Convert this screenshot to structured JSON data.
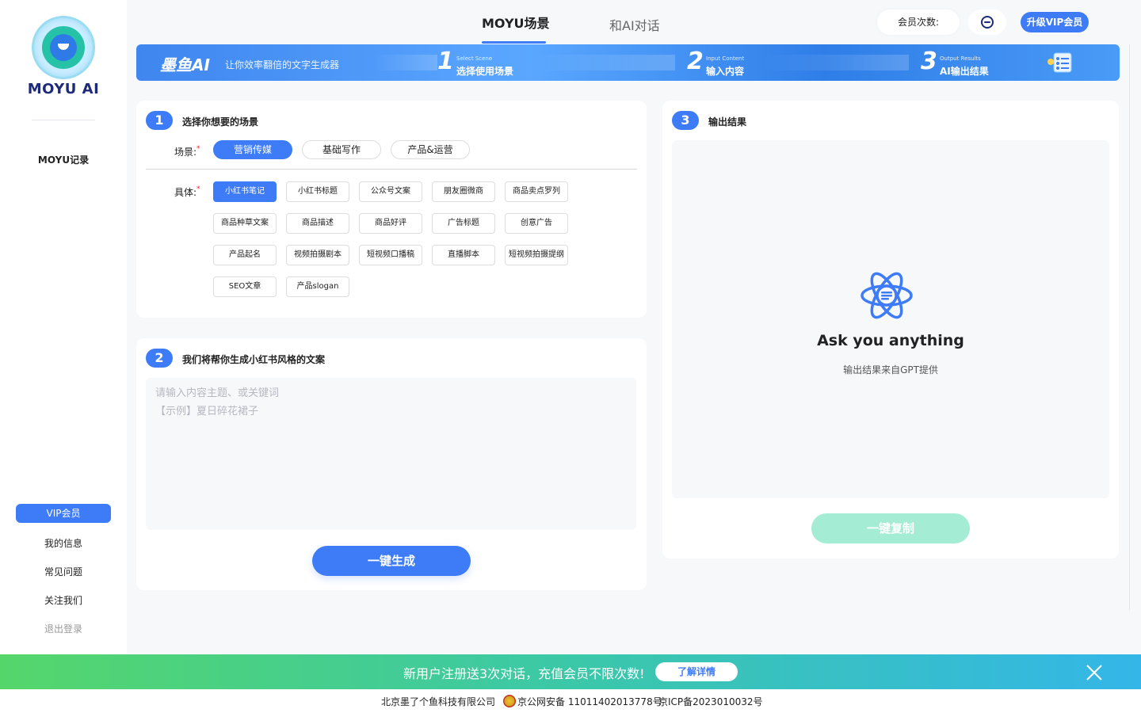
{
  "sidebar": {
    "brand": "MOYU AI",
    "record": "MOYU记录",
    "vip": "VIP会员",
    "links": [
      "我的信息",
      "常见问题",
      "关注我们"
    ],
    "logout": "退出登录"
  },
  "header": {
    "tabs": [
      "MOYU场景",
      "和AI对话"
    ],
    "member_count_label": "会员次数:",
    "upgrade": "升级VIP会员"
  },
  "banner": {
    "brand": "墨鱼AI",
    "slogan": "让你效率翻倍的文字生成器",
    "steps": [
      {
        "num": "1",
        "en": "Select Scene",
        "zh": "选择使用场景"
      },
      {
        "num": "2",
        "en": "Input Content",
        "zh": "输入内容"
      },
      {
        "num": "3",
        "en": "Output Results",
        "zh": "AI输出结果"
      }
    ]
  },
  "step1": {
    "num": "1",
    "title": "选择你想要的场景",
    "scene_label": "场景:",
    "categories": [
      "营销传媒",
      "基础写作",
      "产品&运营"
    ],
    "active_category": 0,
    "specific_label": "具体:",
    "chips": [
      "小红书笔记",
      "小红书标题",
      "公众号文案",
      "朋友圈微商",
      "商品卖点罗列",
      "商品种草文案",
      "商品描述",
      "商品好评",
      "广告标题",
      "创意广告",
      "产品起名",
      "视频拍摄剧本",
      "短视频口播稿",
      "直播脚本",
      "短视频拍摄提纲",
      "SEO文章",
      "产品slogan"
    ],
    "active_chip": 0
  },
  "step2": {
    "num": "2",
    "title": "我们将帮你生成小红书风格的文案",
    "placeholder": "请输入内容主题、或关键词\n【示例】夏日碎花裙子",
    "generate": "一键生成"
  },
  "step3": {
    "num": "3",
    "title": "输出结果",
    "ask": "Ask you anything",
    "ask_sub": "输出结果来自GPT提供",
    "copy": "一键复制"
  },
  "promo": {
    "text": "新用户注册送3次对话，充值会员不限次数!",
    "button": "了解详情"
  },
  "footer": {
    "company": "北京墨了个鱼科技有限公司",
    "police": "京公网安备 11011402013778号",
    "icp": "京ICP备2023010032号"
  },
  "colors": {
    "accent": "#3d7bf7",
    "copy_button": "#a4ecd3",
    "promo_start": "#55d66b",
    "promo_end": "#34b6e8"
  }
}
